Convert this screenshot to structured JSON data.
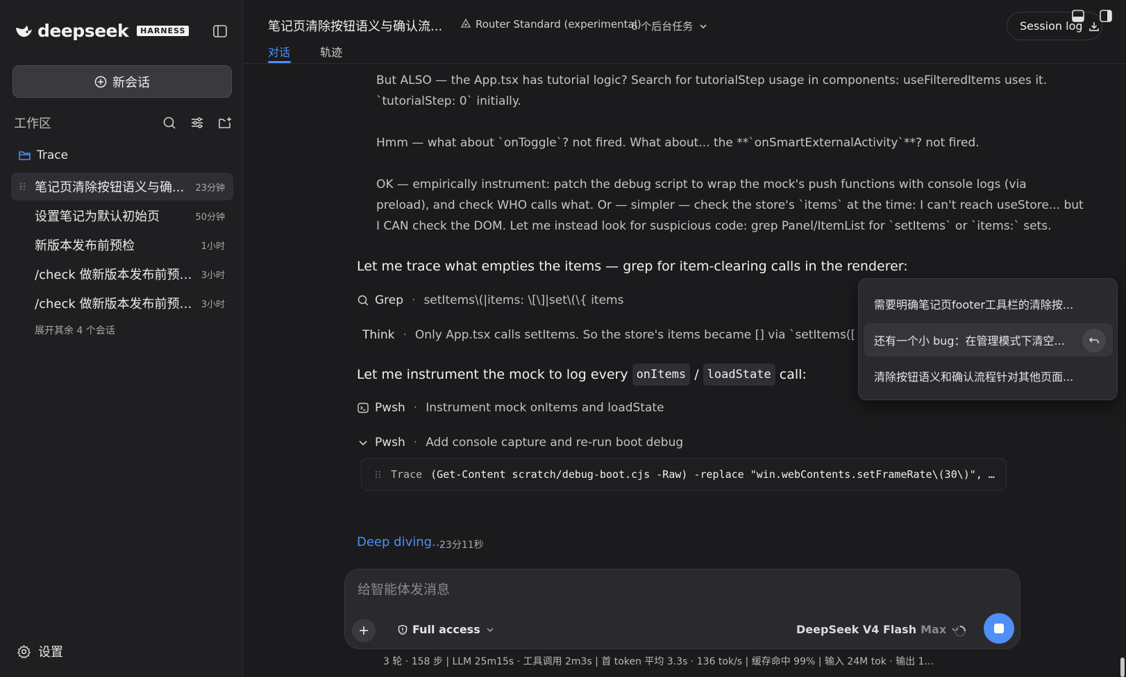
{
  "sidebar": {
    "brand": "deepseek",
    "badge": "HARNESS",
    "new_chat": "新会话",
    "workspace_label": "工作区",
    "folder": "Trace",
    "sessions": [
      {
        "title": "笔记页清除按钮语义与确...",
        "time": "23分钟"
      },
      {
        "title": "设置笔记为默认初始页",
        "time": "50分钟"
      },
      {
        "title": "新版本发布前预检",
        "time": "1小时"
      },
      {
        "title": "/check 做新版本发布前预检...",
        "time": "3小时"
      },
      {
        "title": "/check 做新版本发布前预检...",
        "time": "3小时"
      }
    ],
    "expand_more": "展开其余 4 个会话",
    "settings": "设置"
  },
  "topbar": {
    "title": "笔记页清除按钮语义与确认流...",
    "router": "Router Standard (experimental)",
    "bg_tasks": "6 个后台任务",
    "tabs": [
      "对话",
      "轨迹"
    ],
    "session_log": "Session log"
  },
  "content": {
    "p1": "But ALSO — the App.tsx has tutorial logic? Search for tutorialStep usage in components: useFilteredItems uses it.",
    "p1b": "`tutorialStep: 0` initially.",
    "p2": "Hmm — what about `onToggle`? not fired. What about... the **`onSmartExternalActivity`**? not fired.",
    "p3a": "OK — empirically instrument: patch the debug script to wrap the mock's push functions with console logs (via",
    "p3b": "preload), and check WHO calls what. Or — simpler — check the store's `items` at the time: I can't reach useStore... but",
    "p3c": "I CAN check the DOM. Let me instead look for suspicious code: grep Panel/ItemList for `setItems` or `items:` sets.",
    "h1": "Let me trace what empties the items — grep for item-clearing calls in the renderer:",
    "grep": {
      "tool": "Grep",
      "detail": "setItems\\(|items: \\[\\]|set\\(\\{ items"
    },
    "think": {
      "tool": "Think",
      "detail": "Only App.tsx calls setItems. So the store's items became [] via `setItems([])` — mea"
    },
    "h2_pre": "Let me instrument the mock to log every",
    "h2_code1": "onItems",
    "h2_slash": "/",
    "h2_code2": "loadState",
    "h2_post": "call:",
    "pwsh1": {
      "tool": "Pwsh",
      "detail": "Instrument mock onItems and loadState"
    },
    "pwsh2": {
      "tool": "Pwsh",
      "detail": "Add console capture and re-run boot debug"
    },
    "code_label": "Trace",
    "code_cmd": "(Get-Content scratch/debug-boot.cjs -Raw) -replace \"win.webContents.setFrameRate\\(30\\)\", …",
    "deep_diving": "Deep diving...",
    "elapsed": "23分11秒"
  },
  "composer": {
    "placeholder": "给智能体发消息",
    "access": "Full access",
    "model": "DeepSeek V4 Flash",
    "tier": "Max"
  },
  "stats": "3 轮 · 158 步   |   LLM 25m15s · 工具调用 2m3s   |   首 token 平均 3.3s · 136 tok/s   |   缓存命中 99%   |   输入 24M tok · 输出 1...",
  "popover": {
    "items": [
      "需要明确笔记页footer工具栏的清除按...",
      "还有一个小 bug：在管理模式下清空...",
      "清除按钮语义和确认流程针对其他页面..."
    ]
  },
  "colors": {
    "accent": "#4f8ff7",
    "background": "#1b1b1d",
    "sidebar": "#1f1f22"
  }
}
